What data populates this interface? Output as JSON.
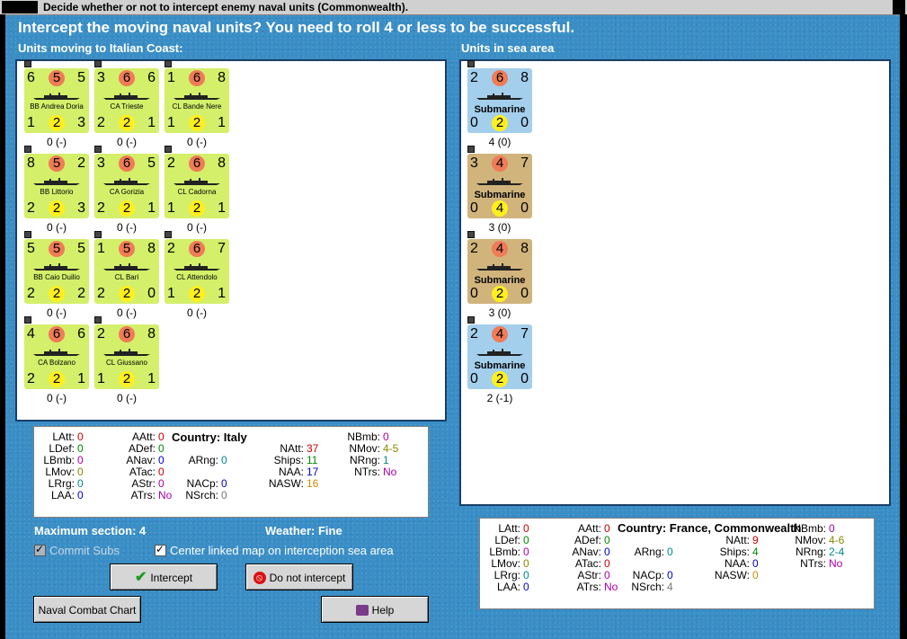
{
  "window": {
    "title": "Decide whether or not to intercept enemy naval units (Commonwealth)."
  },
  "prompt": "Intercept the moving naval units?  You need to roll 4 or less to be successful.",
  "left_section": {
    "label": "Units moving to Italian Coast:",
    "units": [
      {
        "name": "BB Andrea Doria",
        "tl": "6",
        "tc": "5",
        "tr": "5",
        "bl": "1",
        "bc": "2",
        "br": "3",
        "count": "0 (-)"
      },
      {
        "name": "CA Trieste",
        "tl": "3",
        "tc": "6",
        "tr": "6",
        "bl": "2",
        "bc": "2",
        "br": "1",
        "count": "0 (-)"
      },
      {
        "name": "CL Bande Nere",
        "tl": "1",
        "tc": "6",
        "tr": "8",
        "bl": "1",
        "bc": "2",
        "br": "1",
        "count": "0 (-)"
      },
      {
        "name": "BB Littorio",
        "tl": "8",
        "tc": "5",
        "tr": "2",
        "bl": "2",
        "bc": "2",
        "br": "3",
        "count": "0 (-)"
      },
      {
        "name": "CA Gorizia",
        "tl": "3",
        "tc": "6",
        "tr": "5",
        "bl": "2",
        "bc": "2",
        "br": "1",
        "count": "0 (-)"
      },
      {
        "name": "CL Cadorna",
        "tl": "2",
        "tc": "6",
        "tr": "8",
        "bl": "1",
        "bc": "2",
        "br": "1",
        "count": "0 (-)"
      },
      {
        "name": "BB Caio Duilio",
        "tl": "5",
        "tc": "5",
        "tr": "5",
        "bl": "2",
        "bc": "2",
        "br": "2",
        "count": "0 (-)"
      },
      {
        "name": "CL Bari",
        "tl": "1",
        "tc": "5",
        "tr": "8",
        "bl": "2",
        "bc": "2",
        "br": "0",
        "count": "0 (-)"
      },
      {
        "name": "CL Attendolo",
        "tl": "2",
        "tc": "6",
        "tr": "7",
        "bl": "1",
        "bc": "2",
        "br": "1",
        "count": "0 (-)"
      },
      {
        "name": "CA Bolzano",
        "tl": "4",
        "tc": "6",
        "tr": "6",
        "bl": "2",
        "bc": "2",
        "br": "1",
        "count": "0 (-)"
      },
      {
        "name": "CL Giussano",
        "tl": "2",
        "tc": "6",
        "tr": "8",
        "bl": "1",
        "bc": "2",
        "br": "1",
        "count": "0 (-)"
      }
    ]
  },
  "right_section": {
    "label": "Units in sea area",
    "units": [
      {
        "name": "Submarine",
        "tl": "2",
        "tc": "6",
        "tr": "8",
        "bl": "0",
        "bc": "2",
        "br": "0",
        "count": "4 (0)",
        "color": "blue"
      },
      {
        "name": "Submarine",
        "tl": "3",
        "tc": "4",
        "tr": "7",
        "bl": "0",
        "bc": "4",
        "br": "0",
        "count": "3 (0)",
        "color": "tan"
      },
      {
        "name": "Submarine",
        "tl": "2",
        "tc": "4",
        "tr": "8",
        "bl": "0",
        "bc": "2",
        "br": "0",
        "count": "3 (0)",
        "color": "tan"
      },
      {
        "name": "Submarine",
        "tl": "2",
        "tc": "4",
        "tr": "7",
        "bl": "0",
        "bc": "2",
        "br": "0",
        "count": "2 (-1)",
        "color": "blue"
      }
    ]
  },
  "italy_stats": {
    "country": "Country: Italy",
    "colors": {
      "zero": "#cc0000",
      "green": "#008800",
      "purple": "#aa00aa",
      "olive": "#888800",
      "blue": "#0000cc",
      "teal": "#008888",
      "orange": "#cc8800",
      "gray": "#777777",
      "red": "#cc0000"
    },
    "items": [
      {
        "k": "LAtt:",
        "v": "0",
        "c": "#cc0000"
      },
      {
        "k": "LDef:",
        "v": "0",
        "c": "#008800"
      },
      {
        "k": "LBmb:",
        "v": "0",
        "c": "#aa00aa"
      },
      {
        "k": "LMov:",
        "v": "0",
        "c": "#888800"
      },
      {
        "k": "LRrg:",
        "v": "0",
        "c": "#008888"
      },
      {
        "k": "LAA:",
        "v": "0",
        "c": "#0000cc"
      },
      {
        "k": "AAtt:",
        "v": "0",
        "c": "#cc0000"
      },
      {
        "k": "ADef:",
        "v": "0",
        "c": "#008800"
      },
      {
        "k": "ANav:",
        "v": "0",
        "c": "#0000cc"
      },
      {
        "k": "ATac:",
        "v": "0",
        "c": "#cc0000"
      },
      {
        "k": "AStr:",
        "v": "0",
        "c": "#aa00aa"
      },
      {
        "k": "ATrs:",
        "v": "No",
        "c": "#aa00aa"
      },
      {
        "k": "ARng:",
        "v": "0",
        "c": "#008888"
      },
      {
        "k": "NACp:",
        "v": "0",
        "c": "#0000cc"
      },
      {
        "k": "NSrch:",
        "v": "0",
        "c": "#777777"
      },
      {
        "k": "NAtt:",
        "v": "37",
        "c": "#cc0000"
      },
      {
        "k": "Ships:",
        "v": "11",
        "c": "#008800"
      },
      {
        "k": "NAA:",
        "v": "17",
        "c": "#0000cc"
      },
      {
        "k": "NASW:",
        "v": "16",
        "c": "#cc8800"
      },
      {
        "k": "NBmb:",
        "v": "0",
        "c": "#aa00aa"
      },
      {
        "k": "NMov:",
        "v": "4-5",
        "c": "#888800"
      },
      {
        "k": "NRng:",
        "v": "1",
        "c": "#008888"
      },
      {
        "k": "NTrs:",
        "v": "No",
        "c": "#aa00aa"
      }
    ]
  },
  "france_stats": {
    "country": "Country: France, Commonwealth",
    "items": [
      {
        "k": "LAtt:",
        "v": "0",
        "c": "#cc0000"
      },
      {
        "k": "LDef:",
        "v": "0",
        "c": "#008800"
      },
      {
        "k": "LBmb:",
        "v": "0",
        "c": "#aa00aa"
      },
      {
        "k": "LMov:",
        "v": "0",
        "c": "#888800"
      },
      {
        "k": "LRrg:",
        "v": "0",
        "c": "#008888"
      },
      {
        "k": "LAA:",
        "v": "0",
        "c": "#0000cc"
      },
      {
        "k": "AAtt:",
        "v": "0",
        "c": "#cc0000"
      },
      {
        "k": "ADef:",
        "v": "0",
        "c": "#008800"
      },
      {
        "k": "ANav:",
        "v": "0",
        "c": "#0000cc"
      },
      {
        "k": "ATac:",
        "v": "0",
        "c": "#cc0000"
      },
      {
        "k": "AStr:",
        "v": "0",
        "c": "#aa00aa"
      },
      {
        "k": "ATrs:",
        "v": "No",
        "c": "#aa00aa"
      },
      {
        "k": "ARng:",
        "v": "0",
        "c": "#008888"
      },
      {
        "k": "NACp:",
        "v": "0",
        "c": "#0000cc"
      },
      {
        "k": "NSrch:",
        "v": "4",
        "c": "#777777"
      },
      {
        "k": "NAtt:",
        "v": "9",
        "c": "#cc0000"
      },
      {
        "k": "Ships:",
        "v": "4",
        "c": "#008800"
      },
      {
        "k": "NAA:",
        "v": "0",
        "c": "#0000cc"
      },
      {
        "k": "NASW:",
        "v": "0",
        "c": "#cc8800"
      },
      {
        "k": "NBmb:",
        "v": "0",
        "c": "#aa00aa"
      },
      {
        "k": "NMov:",
        "v": "4-6",
        "c": "#888800"
      },
      {
        "k": "NRng:",
        "v": "2-4",
        "c": "#008888"
      },
      {
        "k": "NTrs:",
        "v": "No",
        "c": "#aa00aa"
      }
    ]
  },
  "info": {
    "max_section": "Maximum section: 4",
    "weather": "Weather:  Fine"
  },
  "options": {
    "commit_subs": {
      "label": "Commit Subs",
      "checked": true,
      "enabled": false
    },
    "center_map": {
      "label": "Center linked map on interception sea area",
      "checked": true,
      "enabled": true
    }
  },
  "buttons": {
    "intercept": "Intercept",
    "do_not_intercept": "Do not intercept",
    "naval_chart": "Naval Combat Chart",
    "help": "Help"
  }
}
